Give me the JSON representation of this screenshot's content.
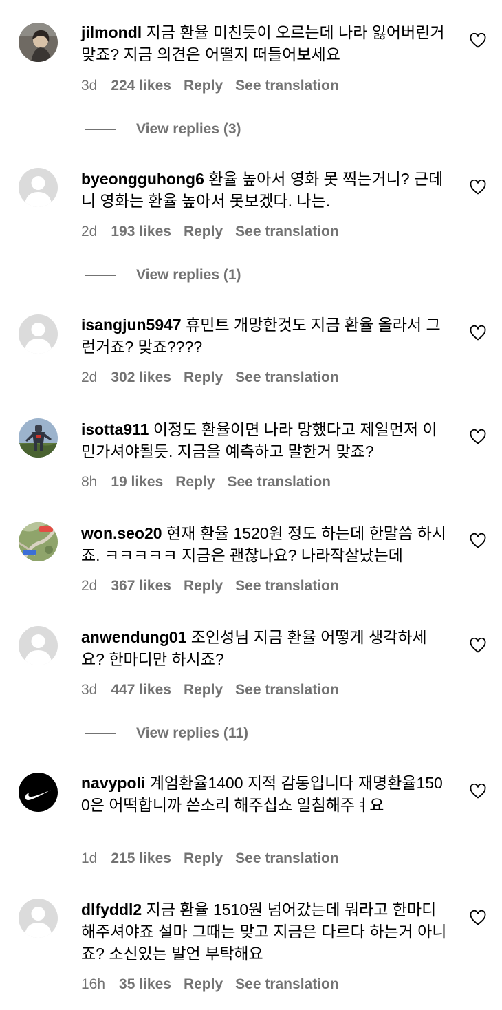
{
  "colors": {
    "text": "#000000",
    "meta": "#737373",
    "avatar_bg": "#dbdbdb",
    "avatar_fg": "#ffffff"
  },
  "comments": [
    {
      "username": "jilmondl",
      "text": "지금 환율 미친듯이 오르는데 나라 잃어버린거 맞죠? 지금 의견은 어떨지 떠들어보세요",
      "time": "3d",
      "likes": "224 likes",
      "reply": "Reply",
      "translation": "See translation",
      "avatar": "photo-avatar",
      "view_replies": "View replies (3)"
    },
    {
      "username": "byeongguhong6",
      "text": "환율 높아서 영화 못 찍는거니? 근데 니 영화는 환율 높아서 못보겠다. 나는.",
      "time": "2d",
      "likes": "193 likes",
      "reply": "Reply",
      "translation": "See translation",
      "avatar": "default-avatar",
      "view_replies": "View replies (1)"
    },
    {
      "username": "isangjun5947",
      "text": "휴민트 개망한것도 지금 환율 올라서 그런거죠? 맞죠????",
      "time": "2d",
      "likes": "302 likes",
      "reply": "Reply",
      "translation": "See translation",
      "avatar": "default-avatar"
    },
    {
      "username": "isotta911",
      "text": "이정도 환율이면 나라 망했다고 제일먼저 이민가셔야될듯. 지금을 예측하고 말한거 맞죠?",
      "time": "8h",
      "likes": "19 likes",
      "reply": "Reply",
      "translation": "See translation",
      "avatar": "robot-photo-avatar"
    },
    {
      "username": "won.seo20",
      "text": "현재 환율 1520원 정도 하는데 한말씀 하시죠. ㅋㅋㅋㅋㅋ 지금은 괜찮나요? 나라작살났는데",
      "time": "2d",
      "likes": "367 likes",
      "reply": "Reply",
      "translation": "See translation",
      "avatar": "map-photo-avatar"
    },
    {
      "username": "anwendung01",
      "text": "조인성님 지금 환율 어떻게 생각하세요? 한마디만 하시죠?",
      "time": "3d",
      "likes": "447 likes",
      "reply": "Reply",
      "translation": "See translation",
      "avatar": "default-avatar",
      "view_replies": "View replies (11)"
    },
    {
      "username": "navypoli",
      "text": "계엄환율1400 지적 감동입니다 재명환율1500은 어떡합니까 쓴소리 해주십쇼 일침해주ㅕ요",
      "time": "1d",
      "likes": "215 likes",
      "reply": "Reply",
      "translation": "See translation",
      "avatar": "swoosh-logo-avatar"
    },
    {
      "username": "dlfyddl2",
      "text": "지금 환율 1510원 넘어갔는데 뭐라고 한마디 해주셔야죠 설마 그때는 맞고 지금은 다르다 하는거 아니죠? 소신있는 발언 부탁해요",
      "time": "16h",
      "likes": "35 likes",
      "reply": "Reply",
      "translation": "See translation",
      "avatar": "default-avatar"
    }
  ]
}
